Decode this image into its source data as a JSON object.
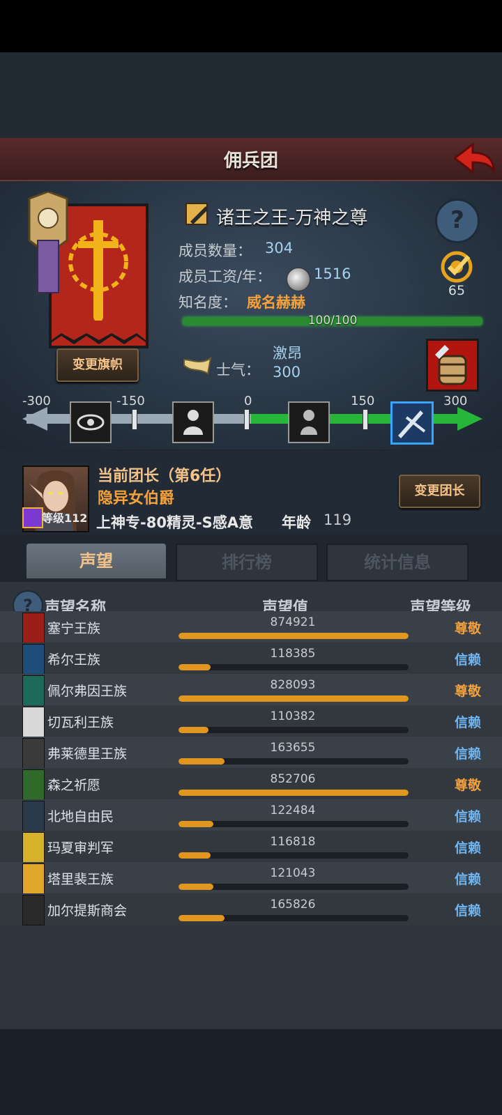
{
  "header": {
    "title": "佣兵团"
  },
  "guild": {
    "name": "诸王之王-万神之尊",
    "members_label": "成员数量：",
    "members": "304",
    "wage_label": "成员工资/年：",
    "wage": "1516",
    "fame_label": "知名度：",
    "fame_value": "威名赫赫",
    "fame_progress": "100/100",
    "fame_fraction": 1.0,
    "change_banner_label": "变更旗帜",
    "target_count": "65",
    "morale_label": "士气：",
    "morale_word": "激昂",
    "morale_value": "300"
  },
  "morale_scale": {
    "ticks": [
      "-300",
      "-150",
      "0",
      "150",
      "300"
    ],
    "icons": [
      "eye-icon",
      "despair-icon",
      "calm-icon",
      "charge-icon"
    ],
    "current": 300
  },
  "leader": {
    "title": "当前团长（第6任）",
    "name": "隐异女伯爵",
    "level": "等级112",
    "traits": "上神专-80精灵-S感A意",
    "age_label": "年龄",
    "age": "119",
    "change_label": "变更团长"
  },
  "tabs": [
    {
      "label": "声望",
      "active": true
    },
    {
      "label": "排行榜",
      "active": false
    },
    {
      "label": "统计信息",
      "active": false
    }
  ],
  "list": {
    "headers": {
      "name": "声望名称",
      "value": "声望值",
      "level": "声望等级"
    },
    "max_value": 875000,
    "rows": [
      {
        "name": "塞宁王族",
        "value": "874921",
        "fraction": 1.0,
        "level": "尊敬",
        "tier": "honored",
        "color": "#9a1f18"
      },
      {
        "name": "希尔王族",
        "value": "118385",
        "fraction": 0.14,
        "level": "信赖",
        "tier": "trusted",
        "color": "#1f4d7a"
      },
      {
        "name": "佩尔弗因王族",
        "value": "828093",
        "fraction": 1.0,
        "level": "尊敬",
        "tier": "honored",
        "color": "#1d6a5a"
      },
      {
        "name": "切瓦利王族",
        "value": "110382",
        "fraction": 0.13,
        "level": "信赖",
        "tier": "trusted",
        "color": "#d8d8d8"
      },
      {
        "name": "弗莱德里王族",
        "value": "163655",
        "fraction": 0.2,
        "level": "信赖",
        "tier": "trusted",
        "color": "#3a3a3a"
      },
      {
        "name": "森之祈愿",
        "value": "852706",
        "fraction": 1.0,
        "level": "尊敬",
        "tier": "honored",
        "color": "#2f6a2a"
      },
      {
        "name": "北地自由民",
        "value": "122484",
        "fraction": 0.15,
        "level": "信赖",
        "tier": "trusted",
        "color": "#2a3a4a"
      },
      {
        "name": "玛夏审判军",
        "value": "116818",
        "fraction": 0.14,
        "level": "信赖",
        "tier": "trusted",
        "color": "#d6b12a"
      },
      {
        "name": "塔里裴王族",
        "value": "121043",
        "fraction": 0.15,
        "level": "信赖",
        "tier": "trusted",
        "color": "#e0a82a"
      },
      {
        "name": "加尔提斯商会",
        "value": "165826",
        "fraction": 0.2,
        "level": "信赖",
        "tier": "trusted",
        "color": "#2a2a2a"
      }
    ]
  }
}
